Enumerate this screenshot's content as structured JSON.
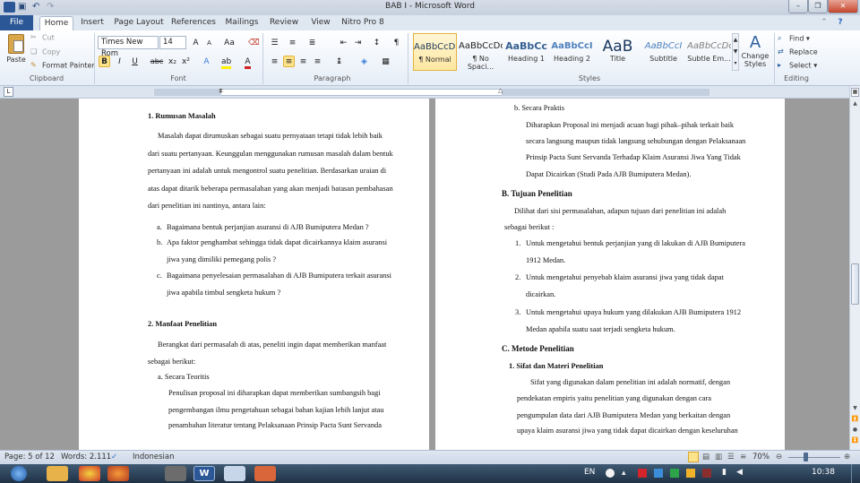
{
  "window": {
    "title": "BAB I - Microsoft Word"
  },
  "tabs": [
    "File",
    "Home",
    "Insert",
    "Page Layout",
    "References",
    "Mailings",
    "Review",
    "View",
    "Nitro Pro 8"
  ],
  "clipboard": {
    "paste": "Paste",
    "cut": "Cut",
    "copy": "Copy",
    "format_painter": "Format Painter",
    "label": "Clipboard"
  },
  "font": {
    "name": "Times New Rom",
    "size": "14",
    "label": "Font",
    "bold": "B",
    "italic": "I",
    "underline": "U",
    "strike": "abc",
    "sub": "x₂",
    "sup": "x²",
    "grow": "A",
    "shrink": "A",
    "change_case": "Aa"
  },
  "paragraph": {
    "label": "Paragraph",
    "pilcrow": "¶"
  },
  "styles": {
    "label": "Styles",
    "items": [
      {
        "sample": "AaBbCcDc",
        "name": "¶ Normal"
      },
      {
        "sample": "AaBbCcDc",
        "name": "¶ No Spaci..."
      },
      {
        "sample": "AaBbCc",
        "name": "Heading 1"
      },
      {
        "sample": "AaBbCcI",
        "name": "Heading 2"
      },
      {
        "sample": "AaB",
        "name": "Title"
      },
      {
        "sample": "AaBbCcI",
        "name": "Subtitle"
      },
      {
        "sample": "AaBbCcDc",
        "name": "Subtle Em..."
      }
    ],
    "change_styles": "Change Styles"
  },
  "editing": {
    "label": "Editing",
    "find": "Find",
    "replace": "Replace",
    "select": "Select"
  },
  "left_page": {
    "h1": "1.   Rumusan Masalah",
    "para1": [
      "Masalah dapat dirumuskan sebagai suatu pernyataan tetapi tidak lebih baik",
      "dari suatu pertanyaan. Keunggulan menggunakan rumusan masalah dalam bentuk",
      "pertanyaan ini adalah untuk mengontrol suatu penelitian. Berdasarkan uraian di",
      "atas dapat ditarik beberapa permasalahan yang akan menjadi batasan pembahasan",
      "dari penelitian ini nantinya, antara lain:"
    ],
    "list": [
      [
        "a.",
        "Bagaimana bentuk perjanjian asuransi di AJB Bumiputera Medan ?"
      ],
      [
        "b.",
        "Apa faktor penghambat sehingga tidak dapat dicairkannya klaim asuransi"
      ],
      [
        "",
        "jiwa yang dimiliki pemegang polis ?"
      ],
      [
        "c.",
        "Bagaimana penyelesaian permasalahan di AJB Bumiputera terkait asuransi"
      ],
      [
        "",
        "jiwa apabila timbul sengketa hukum ?"
      ]
    ],
    "h2": "2.   Manfaat Penelitian",
    "para2": [
      "Berangkat dari permasalah di atas, peneliti ingin dapat memberikan manfaat",
      "sebagai berikut:"
    ],
    "sub_a": "a.     Secara Teoritis",
    "para3": [
      "Penulisan proposal ini diharapkan dapat memberikan sumbangsih bagi",
      "pengembangan ilmu pengetahuan sebagai bahan kajian lebih lanjut atau",
      "penambahan literatur tentang Pelaksanaan Prinsip Pacta Sunt Servanda"
    ]
  },
  "right_page": {
    "sub_b": "b.     Secara Praktis",
    "para1": [
      "Diharapkan Proposal ini menjadi acuan bagi pihak–pihak terkait baik",
      "secara langsung maupun tidak langsung sehubungan dengan Pelaksanaan",
      "Prinsip Pacta Sunt Servanda Terhadap Klaim Asuransi Jiwa Yang Tidak",
      "Dapat Dicairkan (Studi Pada AJB Bumiputera Medan)."
    ],
    "hB": "B.   Tujuan Penelitian",
    "para2": [
      "Dilihat dari sisi permasalahan, adapun tujuan dari penelitian ini adalah",
      "sebagai berikut :"
    ],
    "list": [
      [
        "1.",
        "Untuk mengetahui bentuk perjanjian yang di lakukan di AJB Bumiputera"
      ],
      [
        "",
        "1912 Medan."
      ],
      [
        "2.",
        "Untuk mengetahui penyebab klaim asuransi jiwa yang tidak dapat"
      ],
      [
        "",
        "dicairkan."
      ],
      [
        "3.",
        "Untuk mengetahui upaya hukum yang dilakukan AJB Bumiputera 1912"
      ],
      [
        "",
        "Medan apabila suatu saat terjadi sengketa hukum."
      ]
    ],
    "hC": "C.   Metode Penelitian",
    "h1": "1.   Sifat dan Materi Penelitian",
    "para3": [
      "Sifat yang digunakan dalam penelitian ini adalah normatif, dengan",
      "pendekatan empiris yaitu penelitian yang digunakan dengan cara",
      "pengumpulan data dari AJB Bumiputera Medan yang berkaitan dengan",
      "upaya klaim asuransi jiwa yang tidak dapat dicairkan dengan keseluruhan"
    ]
  },
  "status": {
    "page": "Page: 5 of 12",
    "words": "Words: 2.111",
    "language": "Indonesian",
    "zoom": "70%"
  },
  "taskbar": {
    "lang": "EN",
    "time": "10:38"
  }
}
